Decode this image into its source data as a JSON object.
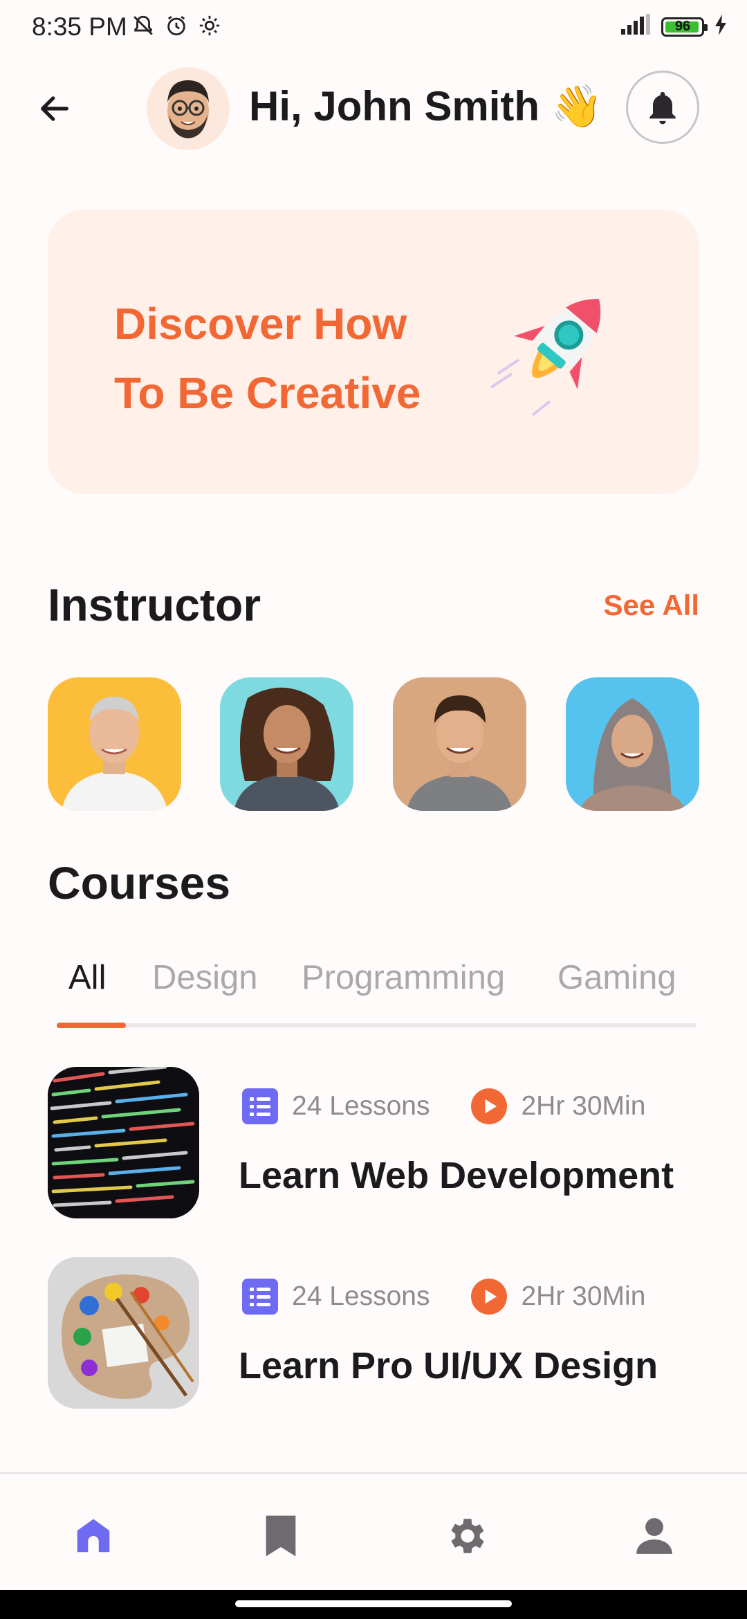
{
  "status_bar": {
    "time": "8:35 PM",
    "battery": "96",
    "battery_level": 0.96,
    "icons": [
      "mute-bell-icon",
      "alarm-icon",
      "settings-gear-icon",
      "signal-icon",
      "battery-icon",
      "charging-bolt-icon"
    ]
  },
  "header": {
    "greeting": "Hi, John Smith 👋",
    "back_icon": "arrow-left-icon",
    "bell_icon": "bell-icon"
  },
  "banner": {
    "line1": "Discover How",
    "line2": "To Be Creative",
    "art": "rocket-illustration"
  },
  "instructors": {
    "title": "Instructor",
    "see_all": "See All",
    "items": [
      {
        "bg": "#fbbd3a"
      },
      {
        "bg": "#7fd9e0"
      },
      {
        "bg": "#d9a77f"
      },
      {
        "bg": "#55c3ee"
      }
    ]
  },
  "courses": {
    "title": "Courses",
    "tabs": [
      {
        "label": "All",
        "active": true
      },
      {
        "label": "Design",
        "active": false
      },
      {
        "label": "Programming",
        "active": false
      },
      {
        "label": "Gaming",
        "active": false
      }
    ],
    "items": [
      {
        "lessons": "24 Lessons",
        "duration": "2Hr 30Min",
        "title": "Learn Web Development"
      },
      {
        "lessons": "24 Lessons",
        "duration": "2Hr 30Min",
        "title": "Learn Pro UI/UX Design"
      }
    ]
  },
  "bottom_nav": {
    "items": [
      "home-icon",
      "bookmark-icon",
      "settings-icon",
      "profile-icon"
    ],
    "active_color": "#6f6af2",
    "inactive_color": "#6e6b70"
  },
  "colors": {
    "accent": "#f26835",
    "list_icon": "#6f6af2",
    "banner_bg": "#fff0ea"
  }
}
